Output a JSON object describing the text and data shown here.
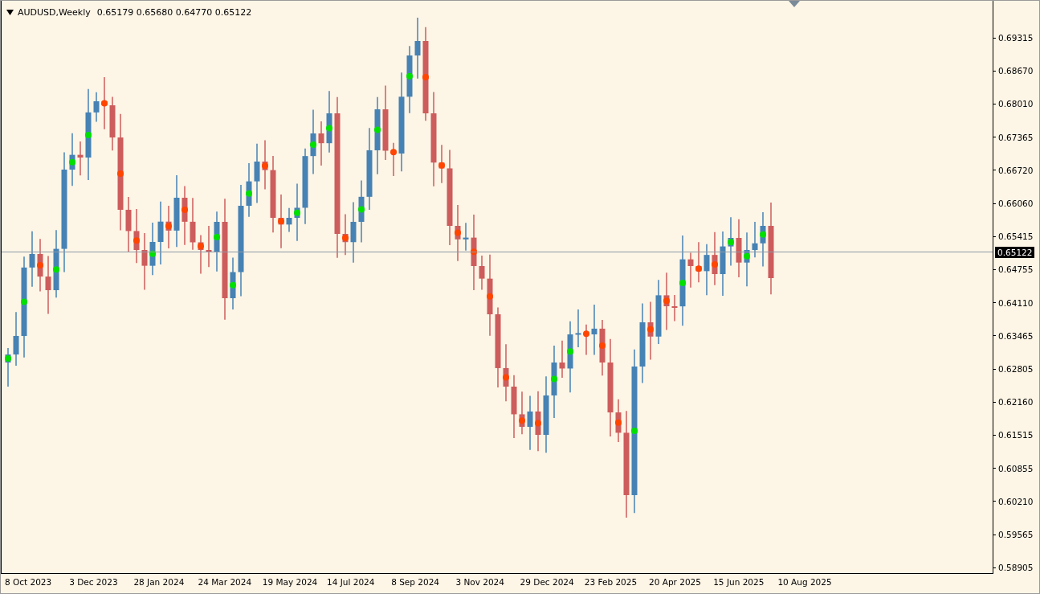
{
  "chart_header": {
    "symbol_period": "AUDUSD,Weekly",
    "values": "0.65179 0.65680 0.64770 0.65122"
  },
  "price_axis": {
    "labels": [
      "0.69315",
      "0.68670",
      "0.68010",
      "0.67365",
      "0.66720",
      "0.66060",
      "0.65415",
      "0.64755",
      "0.64110",
      "0.63465",
      "0.62805",
      "0.62160",
      "0.61515",
      "0.60855",
      "0.60210",
      "0.59565",
      "0.58905"
    ],
    "current_price": "0.65122"
  },
  "time_axis": {
    "labels": [
      "8 Oct 2023",
      "3 Dec 2023",
      "28 Jan 2024",
      "24 Mar 2024",
      "19 May 2024",
      "14 Jul 2024",
      "8 Sep 2024",
      "3 Nov 2024",
      "29 Dec 2024",
      "23 Feb 2025",
      "20 Apr 2025",
      "15 Jun 2025",
      "10 Aug 2025"
    ]
  }
}
